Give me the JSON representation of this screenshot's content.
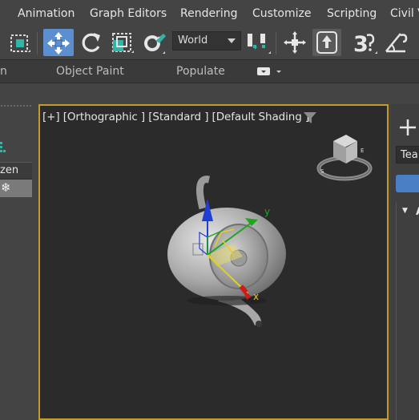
{
  "menu": [
    "Animation",
    "Graph Editors",
    "Rendering",
    "Customize",
    "Scripting",
    "Civil V"
  ],
  "toolbar": {
    "coord_system": "World",
    "icons": [
      "select-region-icon",
      "select-move-icon",
      "select-rotate-icon",
      "select-scale-icon",
      "placement-icon",
      "coord-dropdown-arrow",
      "pivot-icon",
      "select-manipulate-icon",
      "keyboard-shortcut-icon",
      "snaps-3d-icon",
      "angle-snap-icon"
    ]
  },
  "ribbon": {
    "left_tab": "n",
    "object_paint": "Object Paint",
    "populate": "Populate"
  },
  "scene_explorer": {
    "column": "zen"
  },
  "viewport": {
    "label": "[+] [Orthographic ] [Standard ] [Default Shading ]",
    "axis_x": "x",
    "axis_y": "y",
    "accent": "#c29a2e"
  },
  "command_panel": {
    "object_name": "Tea",
    "color": "#4a7fc6",
    "rollout_prefix": "▼",
    "rollout": "A"
  }
}
